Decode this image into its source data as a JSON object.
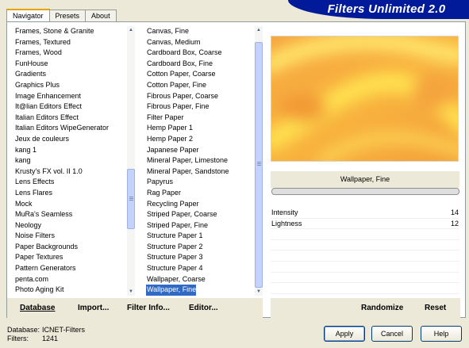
{
  "window": {
    "title": "Filters Unlimited 2.0"
  },
  "tabs": [
    {
      "label": "Navigator"
    },
    {
      "label": "Presets"
    },
    {
      "label": "About"
    }
  ],
  "categories": [
    "Frames, Stone & Granite",
    "Frames, Textured",
    "Frames, Wood",
    "FunHouse",
    "Gradients",
    "Graphics Plus",
    "Image Enhancement",
    "It@lian Editors Effect",
    "Italian Editors Effect",
    "Italian Editors WipeGenerator",
    "Jeux de couleurs",
    "kang 1",
    "kang",
    "Krusty's FX vol. II 1.0",
    "Lens Effects",
    "Lens Flares",
    "Mock",
    "MuRa's Seamless",
    "Neology",
    "Noise Filters",
    "Paper Backgrounds",
    "Paper Textures",
    "Pattern Generators",
    "penta.com",
    "Photo Aging Kit"
  ],
  "filters": [
    "Canvas, Fine",
    "Canvas, Medium",
    "Cardboard Box, Coarse",
    "Cardboard Box, Fine",
    "Cotton Paper, Coarse",
    "Cotton Paper, Fine",
    "Fibrous Paper, Coarse",
    "Fibrous Paper, Fine",
    "Filter Paper",
    "Hemp Paper 1",
    "Hemp Paper 2",
    "Japanese Paper",
    "Mineral Paper, Limestone",
    "Mineral Paper, Sandstone",
    "Papyrus",
    "Rag Paper",
    "Recycling Paper",
    "Striped Paper, Coarse",
    "Striped Paper, Fine",
    "Structure Paper 1",
    "Structure Paper 2",
    "Structure Paper 3",
    "Structure Paper 4",
    "Wallpaper, Coarse",
    "Wallpaper, Fine"
  ],
  "selected_filter": "Wallpaper, Fine",
  "toolbar": {
    "database": "Database",
    "import": "Import...",
    "filter_info": "Filter Info...",
    "editor": "Editor...",
    "randomize": "Randomize",
    "reset": "Reset"
  },
  "params": [
    {
      "label": "Intensity",
      "value": "14"
    },
    {
      "label": "Lightness",
      "value": "12"
    }
  ],
  "status": {
    "database_label": "Database:",
    "database_value": "ICNET-Filters",
    "filters_label": "Filters:",
    "filters_value": "1241"
  },
  "buttons": {
    "apply": "Apply",
    "cancel": "Cancel",
    "help": "Help"
  },
  "colors": {
    "banner": "#001a99",
    "selection": "#316ac5",
    "tab_accent": "#e7a300"
  }
}
